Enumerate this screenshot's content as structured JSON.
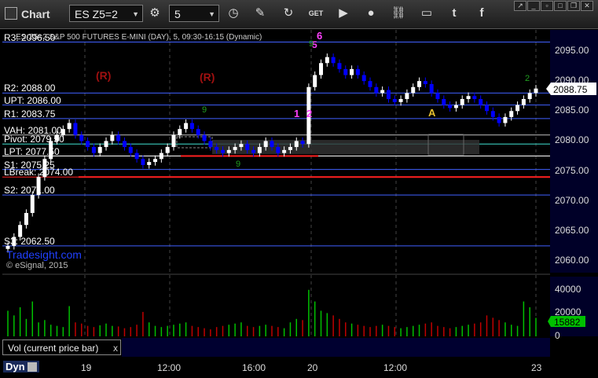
{
  "toolbar": {
    "title": "Chart",
    "symbol": "ES Z5=2",
    "interval": "5",
    "icons": [
      "chart-icon",
      "symbol-dropdown-icon",
      "settings-gear-icon",
      "interval-dropdown-icon",
      "clock-icon",
      "pencil-icon",
      "refresh-icon",
      "get-icon",
      "play-icon",
      "record-icon",
      "link-icon",
      "window-icon",
      "twitter-icon",
      "facebook-icon"
    ]
  },
  "chart_header": "ES-Z5=2 S&P 500 FUTURES E-MINI (DAY), 5, 09:30-16:15 (Dynamic)",
  "levels": [
    {
      "label": "R3: 2096.50",
      "price": 2096.5,
      "color": "#4060ff"
    },
    {
      "label": "R2: 2088.00",
      "price": 2088.0,
      "color": "#4060ff"
    },
    {
      "label": "UPT: 2086.00",
      "price": 2086.0,
      "color": "#4060ff"
    },
    {
      "label": "R1: 2083.75",
      "price": 2083.75,
      "color": "#4060ff"
    },
    {
      "label": "VAH: 2081.00",
      "price": 2081.0,
      "color": "#c0c0c0"
    },
    {
      "label": "Pivot: 2079.50",
      "price": 2079.5,
      "color": "#40e0d0"
    },
    {
      "label": "LPT: 2077.50",
      "price": 2077.5,
      "color": "#ffffff"
    },
    {
      "label": "S1: 2075.25",
      "price": 2075.25,
      "color": "#4060ff"
    },
    {
      "label": "LBreak: 2074.00",
      "price": 2074.0,
      "color": "#ff2020"
    },
    {
      "label": "S2: 2071.00",
      "price": 2071.0,
      "color": "#4060ff"
    },
    {
      "label": "S3: 2062.50",
      "price": 2062.5,
      "color": "#4060ff"
    }
  ],
  "annotations": {
    "r_marker_1": "(R)",
    "r_marker_2": "(R)",
    "pink_1": "1",
    "pink_2": "2",
    "pink_6": "6",
    "pink_5": "5",
    "a_marker": "A",
    "green_count_1": "9",
    "green_count_2": "9",
    "green_count_3": "9",
    "green_count_4": "2"
  },
  "watermark": "Tradesight.com",
  "copyright": "© eSignal, 2015",
  "last_price": "2088.75",
  "volume_last": "15882",
  "volume_legend": "Vol (current price bar)",
  "volume_close": "x",
  "status": {
    "dyn": "Dyn"
  },
  "colors": {
    "up_bar": "#ffffff",
    "down_bar": "#0000ff",
    "vol_up": "#00c000",
    "vol_down": "#c00000",
    "grid": "#555555",
    "background": "#000000",
    "panel_bg": "#000028"
  },
  "chart_data": {
    "type": "candlestick",
    "price_axis": {
      "min": 2060,
      "max": 2095,
      "ticks": [
        "2095.00",
        "2090.00",
        "2085.00",
        "2080.00",
        "2075.00",
        "2070.00",
        "2065.00",
        "2060.00"
      ]
    },
    "time_axis": {
      "ticks": [
        "19",
        "12:00",
        "16:00",
        "20",
        "12:00",
        "23"
      ]
    },
    "volume_axis": {
      "ticks": [
        "40000",
        "20000",
        "0"
      ]
    },
    "close_series": [
      2062.5,
      2064,
      2066,
      2068,
      2071,
      2074,
      2077,
      2080,
      2081,
      2082,
      2083,
      2081,
      2080,
      2079,
      2078,
      2079,
      2080,
      2081,
      2080,
      2079,
      2078,
      2077,
      2076,
      2076.5,
      2077,
      2078,
      2079,
      2081,
      2082,
      2083,
      2082,
      2081,
      2080,
      2079,
      2078.5,
      2078,
      2078.5,
      2079,
      2079.5,
      2078.5,
      2078,
      2079,
      2080,
      2079,
      2078,
      2078.5,
      2079,
      2080,
      2079.5,
      2089,
      2091,
      2093,
      2094,
      2093,
      2092,
      2091,
      2092,
      2091,
      2090,
      2089,
      2088,
      2088.5,
      2087,
      2086.5,
      2087,
      2088,
      2089,
      2090,
      2089.5,
      2088,
      2087,
      2086,
      2085.5,
      2086,
      2087,
      2087.5,
      2087,
      2086,
      2085,
      2084,
      2083,
      2084,
      2085,
      2086,
      2087,
      2088,
      2088.75
    ],
    "volume_series": [
      22000,
      18000,
      25000,
      15000,
      30000,
      12000,
      14000,
      10000,
      9000,
      8000,
      26000,
      12000,
      11000,
      9000,
      8000,
      9500,
      11000,
      9000,
      8500,
      7000,
      8000,
      10000,
      21000,
      12000,
      9000,
      8000,
      9000,
      10000,
      11000,
      12000,
      9000,
      8000,
      7000,
      6000,
      8000,
      9000,
      10000,
      11000,
      12000,
      9000,
      8000,
      9000,
      10000,
      9000,
      8000,
      7000,
      12000,
      15000,
      14000,
      40000,
      30000,
      22000,
      20000,
      18000,
      15000,
      12000,
      11000,
      10000,
      9000,
      8000,
      9000,
      10000,
      9000,
      8000,
      7000,
      8000,
      9000,
      10000,
      11000,
      12000,
      9000,
      8000,
      7000,
      8000,
      9000,
      10000,
      11000,
      12000,
      18000,
      16000,
      14000,
      12000,
      10000,
      9000,
      30000,
      25000,
      15882
    ]
  }
}
